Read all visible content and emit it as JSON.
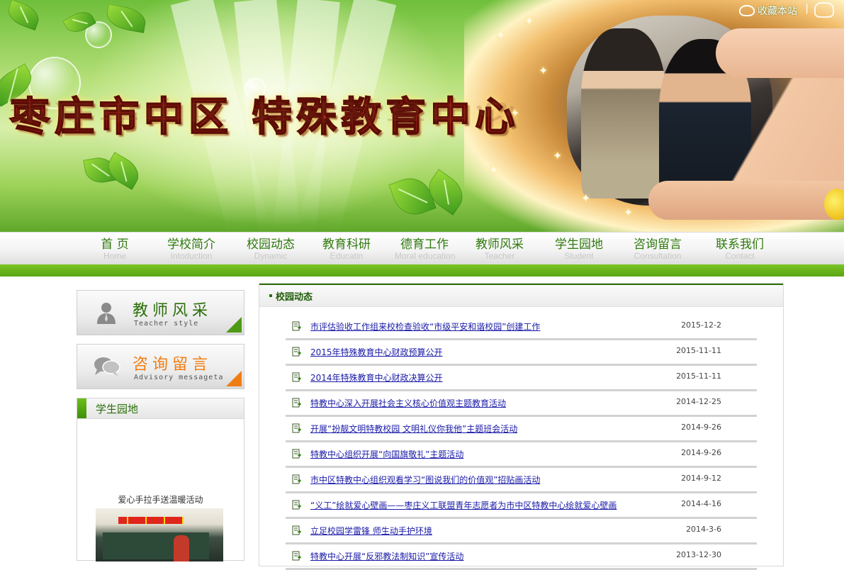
{
  "header": {
    "title": "枣庄市中区 特殊教育中心",
    "favorite_label": "收藏本站",
    "separator": "|"
  },
  "nav": {
    "items": [
      {
        "cn": "首  页",
        "en": "Home"
      },
      {
        "cn": "学校简介",
        "en": "Intoduction"
      },
      {
        "cn": "校园动态",
        "en": "Dynamic"
      },
      {
        "cn": "教育科研",
        "en": "Educatin"
      },
      {
        "cn": "德育工作",
        "en": "Moral education"
      },
      {
        "cn": "教师风采",
        "en": "Teacher"
      },
      {
        "cn": "学生园地",
        "en": "Student"
      },
      {
        "cn": "咨询留言",
        "en": "Consultation"
      },
      {
        "cn": "联系我们",
        "en": "Contact"
      }
    ]
  },
  "sidebar": {
    "teacher": {
      "cn": "教师风采",
      "en": "Teacher style",
      "color": "#2b6f0a"
    },
    "advisory": {
      "cn": "咨询留言",
      "en": "Advisory messageta",
      "color": "#f07d12"
    },
    "student": {
      "title": "学生园地",
      "caption": "爱心手拉手送温暖活动"
    }
  },
  "news": {
    "title": "校园动态",
    "items": [
      {
        "title": "市评估验收工作组来校检查验收“市级平安和谐校园”创建工作",
        "date": "2015-12-2"
      },
      {
        "title": "2015年特殊教育中心财政预算公开",
        "date": "2015-11-11"
      },
      {
        "title": "2014年特殊教育中心财政决算公开",
        "date": "2015-11-11"
      },
      {
        "title": "特教中心深入开展社会主义核心价值观主题教育活动",
        "date": "2014-12-25"
      },
      {
        "title": "开展“扮靓文明特教校园 文明礼仪你我他”主题班会活动",
        "date": "2014-9-26"
      },
      {
        "title": "特教中心组织开展“向国旗敬礼”主题活动",
        "date": "2014-9-26"
      },
      {
        "title": "市中区特教中心组织观看学习“图说我们的价值观”招贴画活动",
        "date": "2014-9-12"
      },
      {
        "title": "“义工”绘就爱心壁画——枣庄义工联盟青年志愿者为市中区特教中心绘就爱心壁画",
        "date": "2014-4-16"
      },
      {
        "title": "立足校园学雷锋 师生动手护环境",
        "date": "2014-3-6"
      },
      {
        "title": "特教中心开展“反邪教法制知识”宣传活动",
        "date": "2013-12-30"
      }
    ]
  },
  "colors": {
    "brand_green": "#2b6f0a",
    "nav_bar_green": "#6ab41b",
    "link_blue": "#1a1aa8",
    "accent_orange": "#f07d12"
  }
}
